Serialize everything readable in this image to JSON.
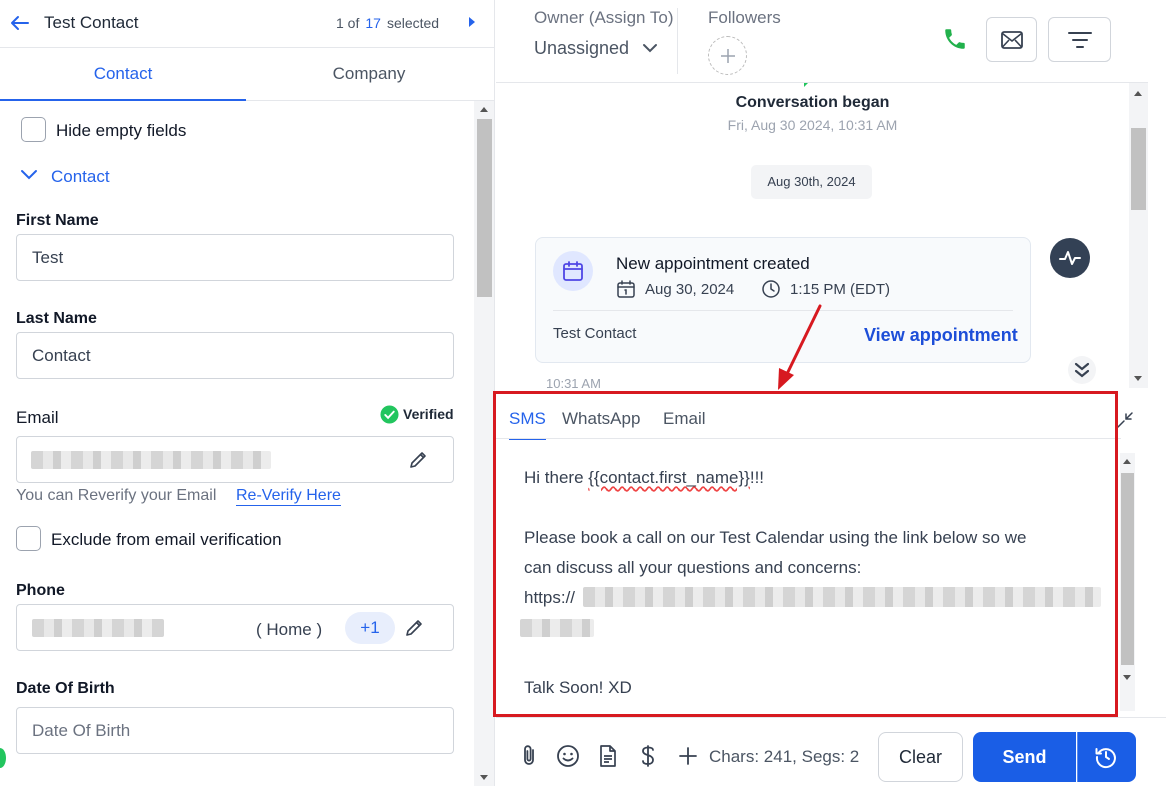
{
  "header": {
    "contact_name": "Test Contact",
    "pager_prefix": "1 of",
    "pager_count": "17",
    "pager_suffix": "selected"
  },
  "tabs": {
    "contact": "Contact",
    "company": "Company"
  },
  "form": {
    "hide_empty_label": "Hide empty fields",
    "section_title": "Contact",
    "first_name_label": "First Name",
    "first_name_value": "Test",
    "last_name_label": "Last Name",
    "last_name_value": "Contact",
    "email_label": "Email",
    "verified_label": "Verified",
    "reverify_text": "You can Reverify your Email",
    "reverify_link": "Re-Verify Here",
    "exclude_label": "Exclude from email verification",
    "phone_label": "Phone",
    "phone_type": "( Home )",
    "phone_country": "+1",
    "dob_label": "Date Of Birth",
    "dob_placeholder": "Date Of Birth"
  },
  "right_header": {
    "owner_label": "Owner (Assign To)",
    "owner_value": "Unassigned",
    "followers_label": "Followers"
  },
  "conversation": {
    "began_title": "Conversation began",
    "began_date": "Fri, Aug 30 2024, 10:31 AM",
    "date_chip": "Aug 30th, 2024",
    "appointment": {
      "title": "New appointment created",
      "date": "Aug 30, 2024",
      "time": "1:15 PM (EDT)",
      "contact": "Test Contact",
      "view_link": "View appointment"
    },
    "message_time": "10:31 AM"
  },
  "composer": {
    "tabs": {
      "sms": "SMS",
      "whatsapp": "WhatsApp",
      "email": "Email"
    },
    "greeting_prefix": "Hi there ",
    "greeting_token": "{{contact.first_name}}",
    "greeting_suffix": "!!!",
    "line2": "Please book a call on our Test Calendar using the link below so we",
    "line3": "can discuss all your questions and concerns:",
    "url_prefix": "https://",
    "signoff": "Talk Soon! XD"
  },
  "toolbar": {
    "chars_label": "Chars: 241, Segs: 2",
    "clear_label": "Clear",
    "send_label": "Send"
  },
  "colors": {
    "accent": "#2563eb",
    "send_button": "#1a5ee6",
    "verified_green": "#22c55e",
    "annotation_red": "#d71920",
    "phone_green": "#22b14c"
  }
}
